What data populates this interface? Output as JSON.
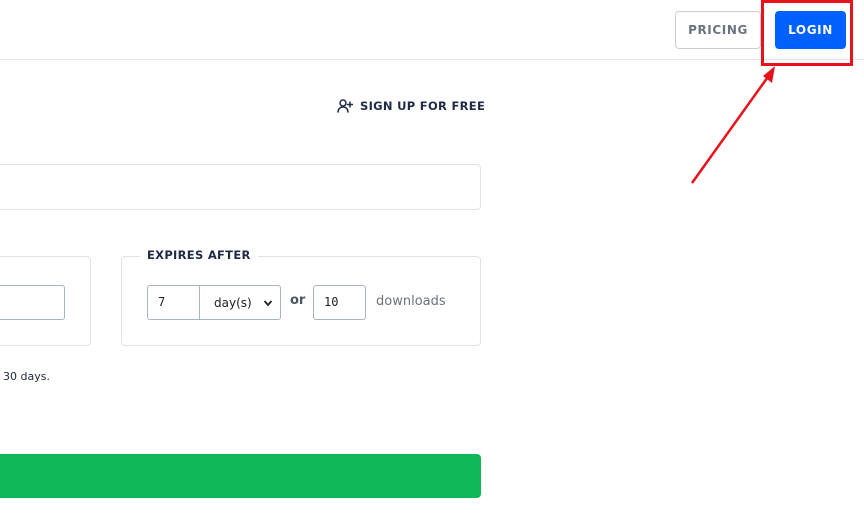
{
  "header": {
    "pricing_label": "PRICING",
    "login_label": "LOGIN"
  },
  "signup": {
    "label": "SIGN UP FOR FREE",
    "icon": "user-plus-icon"
  },
  "expires": {
    "legend": "EXPIRES AFTER",
    "days_value": "7",
    "unit_selected": "day(s)",
    "or_label": "or",
    "downloads_value": "10",
    "downloads_label": "downloads"
  },
  "note": {
    "text": "30 days."
  },
  "colors": {
    "login_bg": "#0061fe",
    "action_green": "#10b759",
    "annotation_red": "#e8121b"
  }
}
